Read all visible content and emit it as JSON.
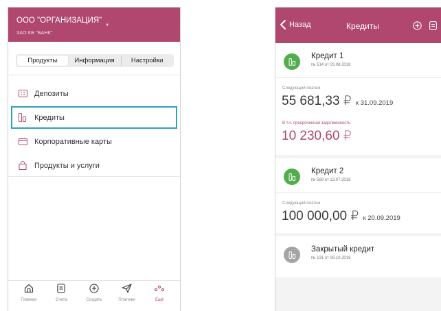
{
  "colors": {
    "brand": "#b0476e",
    "selection": "#2aa3b6",
    "active_credit": "#51ad4e",
    "closed_credit": "#a5a5a5"
  },
  "left_screen": {
    "org_name": "ООО \"ОРГАНИЗАЦИЯ\"",
    "bank_name": "ЗАО КБ \"БАНК\"",
    "tabs": [
      {
        "label": "Продукты",
        "active": true
      },
      {
        "label": "Информация",
        "active": false
      },
      {
        "label": "Настройки",
        "active": false
      }
    ],
    "menu": [
      {
        "label": "Депозиты",
        "icon": "deposit-icon"
      },
      {
        "label": "Кредиты",
        "icon": "credit-icon",
        "selected": true
      },
      {
        "label": "Корпоративные карты",
        "icon": "card-icon"
      },
      {
        "label": "Продукты и услуги",
        "icon": "bag-icon"
      }
    ],
    "bottom_nav": [
      {
        "label": "Главная",
        "icon": "home-icon"
      },
      {
        "label": "Счета",
        "icon": "accounts-icon"
      },
      {
        "label": "Создать",
        "icon": "create-icon"
      },
      {
        "label": "Платежи",
        "icon": "payments-icon"
      },
      {
        "label": "Ещё",
        "icon": "more-icon",
        "active": true
      }
    ]
  },
  "right_screen": {
    "back_label": "Назад",
    "title": "Кредиты",
    "credits": [
      {
        "name": "Кредит 1",
        "contract": "№ 514 от 03.08.2018",
        "next_payment_label": "Следующий платеж",
        "next_payment": "55 681,33 ₽",
        "due": "к 31.09.2019",
        "overdue_label": "В т.ч. просроченная задолженность",
        "overdue": "10 230,60 ₽"
      },
      {
        "name": "Кредит 2",
        "contract": "№ 569 от 13.07.2018",
        "next_payment_label": "Следующий платеж",
        "next_payment": "100 000,00 ₽",
        "due": "к 20.09.2019"
      },
      {
        "name": "Закрытый кредит",
        "contract": "№ 131 от 08.10.2018"
      }
    ]
  }
}
